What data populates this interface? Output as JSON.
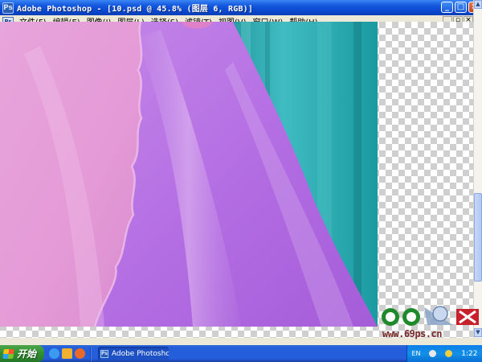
{
  "window": {
    "title": "Adobe Photoshop - [10.psd @ 45.8% (图层 6, RGB)]",
    "app_icon": "photoshop-icon",
    "controls": [
      "minimize-icon",
      "maximize-icon",
      "close-icon"
    ]
  },
  "menubar": {
    "items": [
      {
        "label": "文件(F)"
      },
      {
        "label": "编辑(E)"
      },
      {
        "label": "图像(I)"
      },
      {
        "label": "图层(L)"
      },
      {
        "label": "选择(S)"
      },
      {
        "label": "滤镜(T)"
      },
      {
        "label": "视图(V)"
      },
      {
        "label": "窗口(W)"
      },
      {
        "label": "帮助(H)"
      }
    ]
  },
  "canvas": {
    "document": "10.psd",
    "zoom": "45.8%",
    "layer": "图层 6",
    "mode": "RGB",
    "colors": {
      "pink": "#e49ad6",
      "violet": "#b16ae1",
      "teal": "#1f9aa1"
    }
  },
  "watermark": {
    "text": "www.69ps.cn"
  },
  "taskbar": {
    "start_label": "开始",
    "task_label": "Adobe Photoshop ...",
    "tray": {
      "lang": "EN",
      "clock": "1:22"
    }
  }
}
